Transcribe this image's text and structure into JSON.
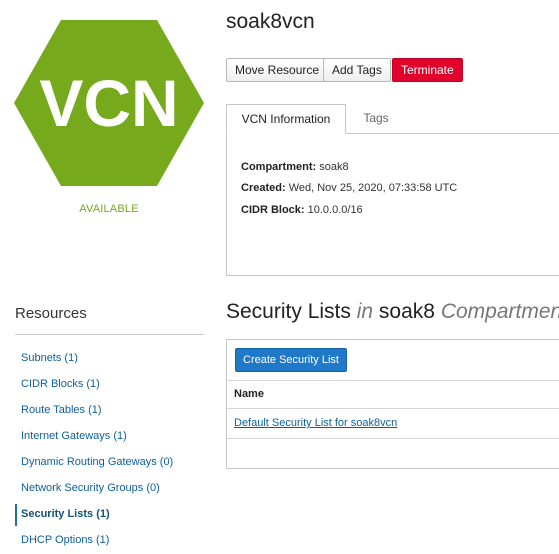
{
  "resource": {
    "badge_text": "VCN",
    "status": "AVAILABLE",
    "name": "soak8vcn"
  },
  "actions": {
    "move_resource": "Move Resource",
    "add_tags": "Add Tags",
    "terminate": "Terminate"
  },
  "tabs": [
    {
      "label": "VCN Information",
      "active": true
    },
    {
      "label": "Tags",
      "active": false
    }
  ],
  "vcn_info": {
    "compartment_label": "Compartment:",
    "compartment_value": "soak8",
    "created_label": "Created:",
    "created_value": "Wed, Nov 25, 2020, 07:33:58 UTC",
    "cidr_label": "CIDR Block:",
    "cidr_value": "10.0.0.0/16"
  },
  "resources": {
    "title": "Resources",
    "items": [
      {
        "label": "Subnets (1)",
        "active": false
      },
      {
        "label": "CIDR Blocks (1)",
        "active": false
      },
      {
        "label": "Route Tables (1)",
        "active": false
      },
      {
        "label": "Internet Gateways (1)",
        "active": false
      },
      {
        "label": "Dynamic Routing Gateways (0)",
        "active": false
      },
      {
        "label": "Network Security Groups (0)",
        "active": false
      },
      {
        "label": "Security Lists (1)",
        "active": true
      },
      {
        "label": "DHCP Options (1)",
        "active": false
      }
    ]
  },
  "security_lists": {
    "title": "Security Lists",
    "in": "in",
    "compartment": "soak8",
    "compartment_suffix": "Compartment",
    "create_button": "Create Security List",
    "columns": [
      "Name"
    ],
    "rows": [
      {
        "name": "Default Security List for soak8vcn"
      }
    ]
  },
  "colors": {
    "badge_green": "#76a91c",
    "terminate_red": "#e0002a",
    "primary_blue": "#1f78c8",
    "link_blue": "#0b5f9e"
  }
}
